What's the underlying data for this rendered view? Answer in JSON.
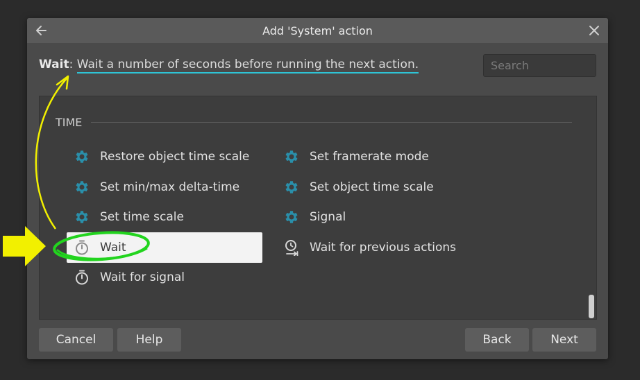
{
  "dialog": {
    "title": "Add 'System' action",
    "back_icon": "back-arrow-icon",
    "close_icon": "close-icon"
  },
  "description": {
    "name": "Wait",
    "text": "Wait a number of seconds before running the next action."
  },
  "search": {
    "placeholder": "Search"
  },
  "section": {
    "title": "TIME"
  },
  "items_left": [
    {
      "label": "Restore object time scale",
      "icon": "gear-icon"
    },
    {
      "label": "Set min/max delta-time",
      "icon": "gear-icon"
    },
    {
      "label": "Set time scale",
      "icon": "gear-icon"
    },
    {
      "label": "Wait",
      "icon": "stopwatch-icon",
      "selected": true
    },
    {
      "label": "Wait for signal",
      "icon": "stopwatch-icon"
    }
  ],
  "items_right": [
    {
      "label": "Set framerate mode",
      "icon": "gear-icon"
    },
    {
      "label": "Set object time scale",
      "icon": "gear-icon"
    },
    {
      "label": "Signal",
      "icon": "gear-icon"
    },
    {
      "label": "Wait for previous actions",
      "icon": "clock-arrow-icon"
    }
  ],
  "buttons": {
    "cancel": "Cancel",
    "help": "Help",
    "back": "Back",
    "next": "Next"
  },
  "colors": {
    "accent_underline": "#2ec4d6",
    "gear_icon": "#2a8faa",
    "annotation_yellow": "#f2f000",
    "annotation_green": "#22d41e"
  }
}
